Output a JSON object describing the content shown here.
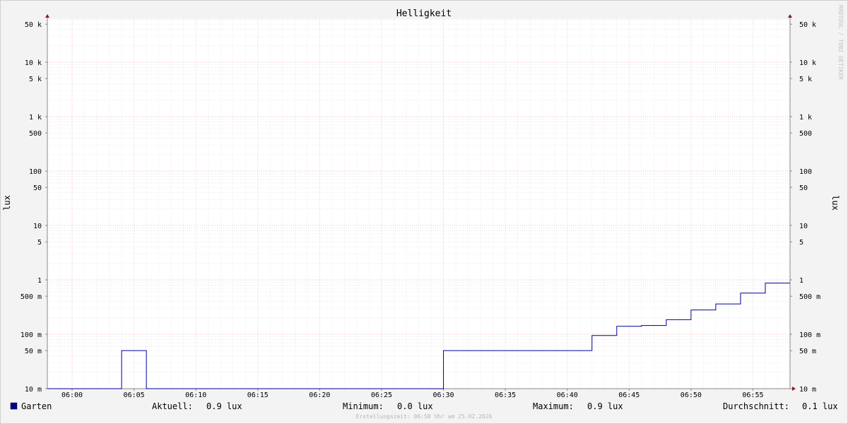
{
  "chart_data": {
    "type": "line",
    "title": "Helligkeit",
    "ylabel": "lux",
    "yscale": "log",
    "ylim": [
      10,
      70000
    ],
    "xlim": [
      "05:58",
      "06:58"
    ],
    "x_ticks": [
      "06:00",
      "06:05",
      "06:10",
      "06:15",
      "06:20",
      "06:25",
      "06:30",
      "06:35",
      "06:40",
      "06:45",
      "06:50",
      "06:55"
    ],
    "y_ticks": [
      {
        "value": 10,
        "label": "10 m"
      },
      {
        "value": 50,
        "label": "50 m"
      },
      {
        "value": 100,
        "label": "100 m"
      },
      {
        "value": 500,
        "label": "500 m"
      },
      {
        "value": 1000,
        "label": "1"
      },
      {
        "value": 5000,
        "label": "5"
      },
      {
        "value": 10000,
        "label": "10"
      },
      {
        "value": 50000,
        "label": "50"
      },
      {
        "value": 100000,
        "label": "100"
      },
      {
        "value": 500000,
        "label": "500"
      },
      {
        "value": 1000000,
        "label": "1 k"
      },
      {
        "value": 5000000,
        "label": "5 k"
      },
      {
        "value": 10000000,
        "label": "10 k"
      },
      {
        "value": 50000000,
        "label": "50 k"
      }
    ],
    "grid": true,
    "series": [
      {
        "name": "Garten",
        "color": "#000099",
        "unit_note": "y values in milli-lux",
        "points": [
          [
            "05:58",
            10
          ],
          [
            "06:04",
            10
          ],
          [
            "06:04",
            50
          ],
          [
            "06:06",
            50
          ],
          [
            "06:06",
            10
          ],
          [
            "06:30",
            10
          ],
          [
            "06:30",
            50
          ],
          [
            "06:42",
            50
          ],
          [
            "06:42",
            95
          ],
          [
            "06:44",
            95
          ],
          [
            "06:44",
            140
          ],
          [
            "06:46",
            140
          ],
          [
            "06:46",
            145
          ],
          [
            "06:48",
            145
          ],
          [
            "06:48",
            185
          ],
          [
            "06:50",
            185
          ],
          [
            "06:50",
            280
          ],
          [
            "06:52",
            280
          ],
          [
            "06:52",
            360
          ],
          [
            "06:54",
            360
          ],
          [
            "06:54",
            570
          ],
          [
            "06:56",
            570
          ],
          [
            "06:56",
            870
          ],
          [
            "06:58",
            870
          ]
        ]
      }
    ]
  },
  "watermark": "RRDTOOL / TOBI OETIKER",
  "legend": {
    "series_name": "Garten",
    "swatch_color": "#000099",
    "current_label": "Aktuell:",
    "current_value": "0.9 lux",
    "min_label": "Minimum:",
    "min_value": "0.0 lux",
    "max_label": "Maximum:",
    "max_value": "0.9 lux",
    "avg_label": "Durchschnitt:",
    "avg_value": "0.1 lux"
  },
  "footer": "Erstellungszeit: 06:58 Uhr am 25.02.2026"
}
